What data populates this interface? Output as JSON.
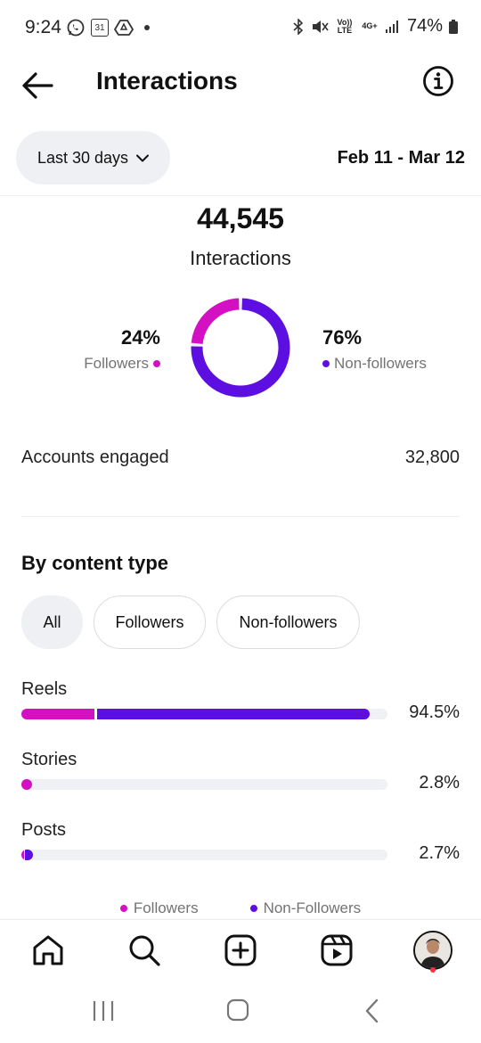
{
  "status_bar": {
    "time": "9:24",
    "calendar_date": "31",
    "network_volte": "Vo)) LTE",
    "network_4g": "4G+",
    "battery": "74%"
  },
  "header": {
    "title": "Interactions"
  },
  "filters": {
    "range_label": "Last 30 days",
    "date_range": "Feb 11 - Mar 12"
  },
  "summary": {
    "total": "44,545",
    "total_label": "Interactions",
    "followers_pct": "24%",
    "followers_label": "Followers",
    "nonfollowers_pct": "76%",
    "nonfollowers_label": "Non-followers",
    "followers_fraction": 0.24,
    "nonfollowers_fraction": 0.76
  },
  "accounts": {
    "label": "Accounts engaged",
    "value": "32,800"
  },
  "content": {
    "title": "By content type",
    "tabs": [
      "All",
      "Followers",
      "Non-followers"
    ],
    "active_tab": "All",
    "rows": [
      {
        "label": "Reels",
        "pct": "94.5%",
        "followers_share": 0.2,
        "nonfollowers_share": 0.745
      },
      {
        "label": "Stories",
        "pct": "2.8%",
        "followers_share": 0.028,
        "nonfollowers_share": 0.0
      },
      {
        "label": "Posts",
        "pct": "2.7%",
        "followers_share": 0.004,
        "nonfollowers_share": 0.023
      }
    ],
    "legend": {
      "followers": "Followers",
      "nonfollowers": "Non-Followers"
    }
  },
  "colors": {
    "followers": "#d311c2",
    "nonfollowers": "#5c0fe0",
    "track": "#eff1f5",
    "pill_bg": "#eef0f3"
  },
  "nav": {
    "icons": [
      "home-icon",
      "search-icon",
      "create-icon",
      "reels-icon",
      "profile-avatar"
    ]
  },
  "system_nav": {
    "icons": [
      "recents-icon",
      "home-circle-icon",
      "back-chevron-icon"
    ]
  }
}
